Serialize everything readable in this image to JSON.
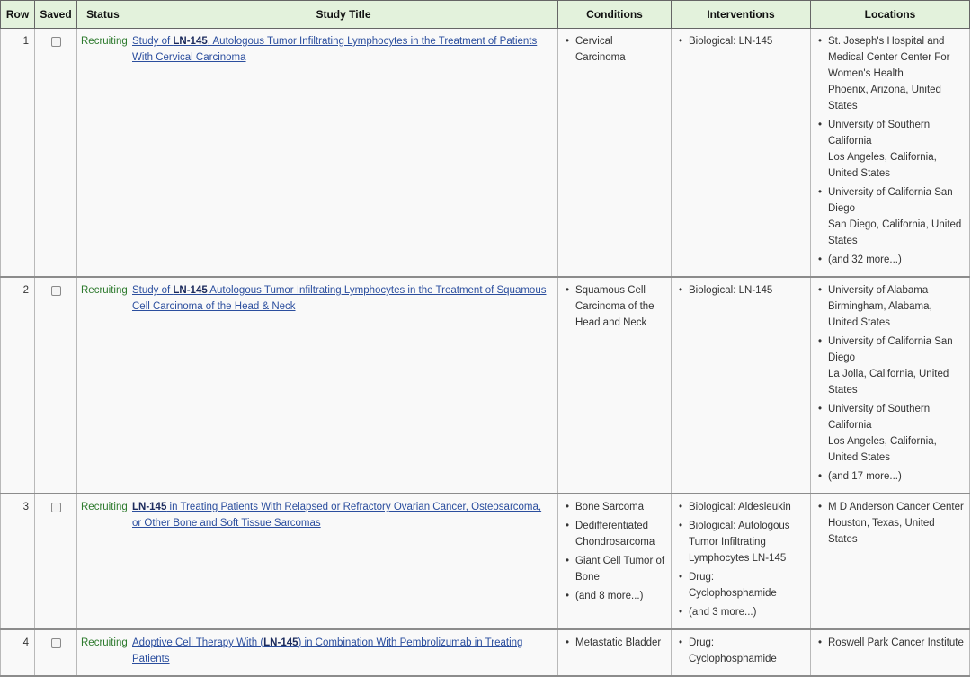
{
  "headers": {
    "row": "Row",
    "saved": "Saved",
    "status": "Status",
    "title": "Study Title",
    "conditions": "Conditions",
    "interventions": "Interventions",
    "locations": "Locations"
  },
  "colors": {
    "header_bg": "#e3f2dc",
    "status_green": "#2d7a2d",
    "link_blue": "#2b4e9e"
  },
  "rows": [
    {
      "num": "1",
      "saved": false,
      "status": "Recruiting",
      "title_pre": "Study of ",
      "title_bold": "LN-145",
      "title_post": ", Autologous Tumor Infiltrating Lymphocytes in the Treatment of Patients With Cervical Carcinoma",
      "conditions": [
        "Cervical Carcinoma"
      ],
      "interventions": [
        "Biological: LN-145"
      ],
      "locations": [
        {
          "name": "St. Joseph's Hospital and Medical Center Center For Women's Health",
          "place": "Phoenix, Arizona, United States"
        },
        {
          "name": "University of Southern California",
          "place": "Los Angeles, California, United States"
        },
        {
          "name": "University of California San Diego",
          "place": "San Diego, California, United States"
        },
        {
          "name": "(and 32 more...)",
          "place": ""
        }
      ]
    },
    {
      "num": "2",
      "saved": false,
      "status": "Recruiting",
      "title_pre": "Study of ",
      "title_bold": "LN-145",
      "title_post": " Autologous Tumor Infiltrating Lymphocytes in the Treatment of Squamous Cell Carcinoma of the Head & Neck",
      "conditions": [
        "Squamous Cell Carcinoma of the Head and Neck"
      ],
      "interventions": [
        "Biological: LN-145"
      ],
      "locations": [
        {
          "name": "University of Alabama",
          "place": "Birmingham, Alabama, United States"
        },
        {
          "name": "University of California San Diego",
          "place": "La Jolla, California, United States"
        },
        {
          "name": "University of Southern California",
          "place": "Los Angeles, California, United States"
        },
        {
          "name": "(and 17 more...)",
          "place": ""
        }
      ]
    },
    {
      "num": "3",
      "saved": false,
      "status": "Recruiting",
      "title_pre": "",
      "title_bold": "LN-145",
      "title_post": " in Treating Patients With Relapsed or Refractory Ovarian Cancer, Osteosarcoma, or Other Bone and Soft Tissue Sarcomas",
      "conditions": [
        "Bone Sarcoma",
        "Dedifferentiated Chondrosarcoma",
        "Giant Cell Tumor of Bone",
        "(and 8 more...)"
      ],
      "interventions": [
        "Biological: Aldesleukin",
        "Biological: Autologous Tumor Infiltrating Lymphocytes LN-145",
        "Drug: Cyclophosphamide",
        "(and 3 more...)"
      ],
      "locations": [
        {
          "name": "M D Anderson Cancer Center",
          "place": "Houston, Texas, United States"
        }
      ]
    },
    {
      "num": "4",
      "saved": false,
      "status": "Recruiting",
      "title_pre": "Adoptive Cell Therapy With (",
      "title_bold": "LN-145",
      "title_post": ") in Combination With Pembrolizumab in Treating Patients",
      "conditions": [
        "Metastatic Bladder"
      ],
      "interventions": [
        "Drug: Cyclophosphamide"
      ],
      "locations": [
        {
          "name": "Roswell Park Cancer Institute",
          "place": ""
        }
      ]
    }
  ]
}
